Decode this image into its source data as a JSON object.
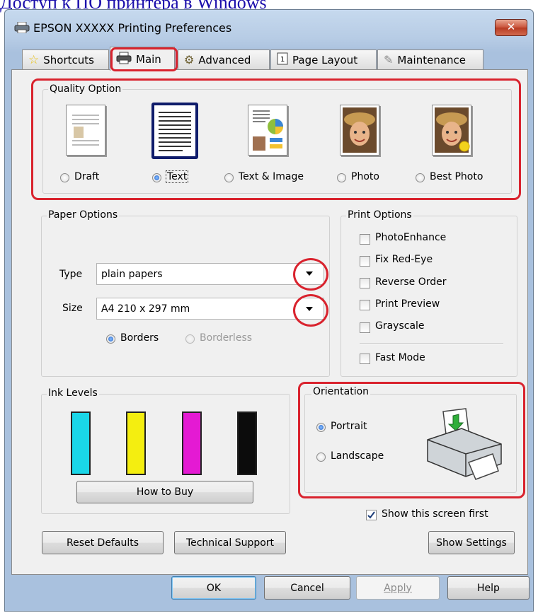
{
  "top_link": "Доступ к ПО принтера в Windows",
  "window": {
    "title": "EPSON XXXXX  Printing Preferences",
    "close": "✕"
  },
  "tabs": [
    {
      "label": "Shortcuts"
    },
    {
      "label": "Main"
    },
    {
      "label": "Advanced"
    },
    {
      "label": "Page Layout"
    },
    {
      "label": "Maintenance"
    }
  ],
  "quality": {
    "title": "Quality Option",
    "options": [
      {
        "label": "Draft",
        "selected": false
      },
      {
        "label": "Text",
        "selected": true
      },
      {
        "label": "Text & Image",
        "selected": false
      },
      {
        "label": "Photo",
        "selected": false
      },
      {
        "label": "Best Photo",
        "selected": false
      }
    ]
  },
  "paper": {
    "title": "Paper Options",
    "type_label": "Type",
    "type_value": "plain papers",
    "size_label": "Size",
    "size_value": "A4 210 x 297 mm",
    "borders": "Borders",
    "borderless": "Borderless"
  },
  "print_options": {
    "title": "Print Options",
    "items": [
      "PhotoEnhance",
      "Fix Red-Eye",
      "Reverse Order",
      "Print Preview",
      "Grayscale"
    ],
    "fast_mode": "Fast Mode"
  },
  "ink": {
    "title": "Ink Levels",
    "colors": [
      "#1ad6e8",
      "#f4ee10",
      "#e41ad3",
      "#0c0c0c"
    ],
    "how_to_buy": "How to Buy"
  },
  "orientation": {
    "title": "Orientation",
    "portrait": "Portrait",
    "landscape": "Landscape",
    "selected": "Portrait"
  },
  "show_screen_first": "Show this screen first",
  "buttons": {
    "reset": "Reset Defaults",
    "tech": "Technical Support",
    "show_settings": "Show Settings",
    "ok": "OK",
    "cancel": "Cancel",
    "apply": "Apply",
    "help": "Help"
  },
  "accent_color": "#d9232e"
}
